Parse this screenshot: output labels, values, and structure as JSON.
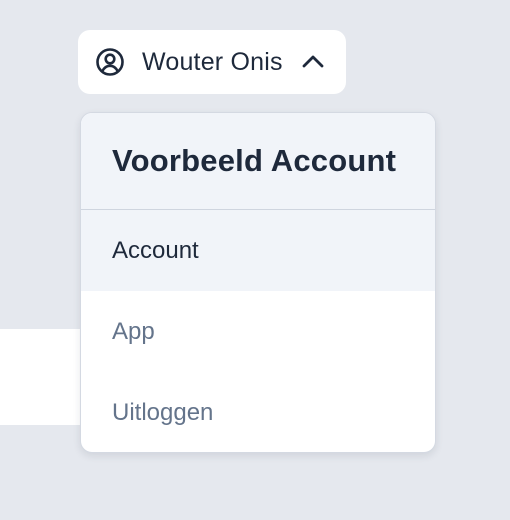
{
  "user_button": {
    "name": "Wouter Onis",
    "icon": "user-circle-icon",
    "chevron_icon": "chevron-up-icon"
  },
  "dropdown": {
    "title": "Voorbeeld Account",
    "items": [
      {
        "label": "Account",
        "active": true
      },
      {
        "label": "App",
        "active": false
      },
      {
        "label": "Uitloggen",
        "active": false
      }
    ]
  },
  "colors": {
    "background": "#e5e8ee",
    "surface": "#ffffff",
    "highlight": "#f1f4f9",
    "text_dark": "#1e293b",
    "text_muted": "#64748b"
  }
}
